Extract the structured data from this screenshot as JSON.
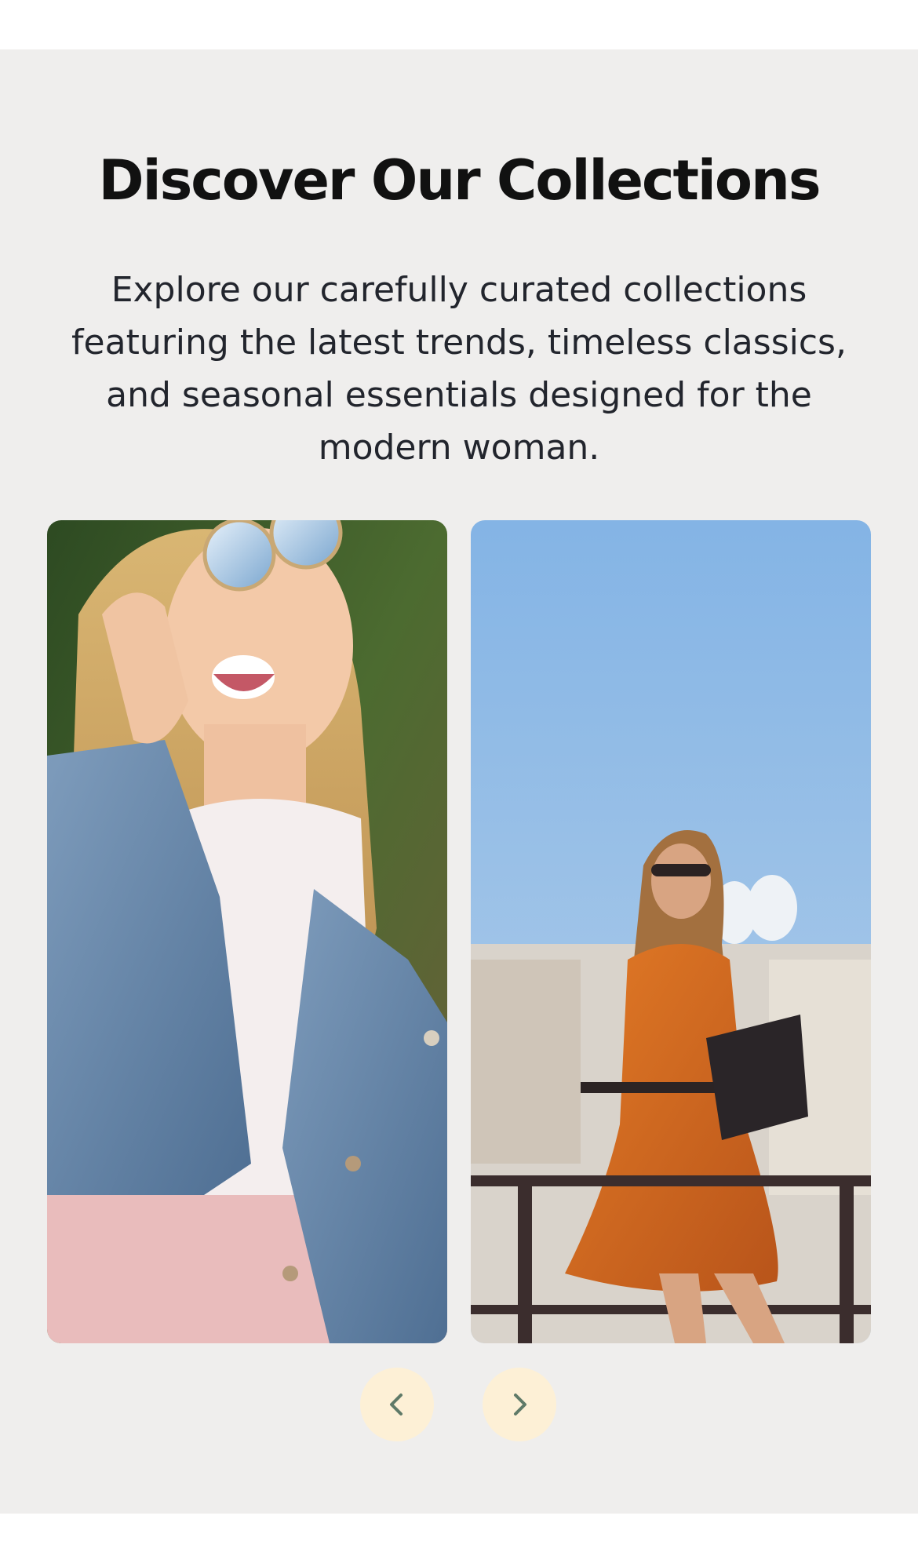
{
  "section": {
    "title": "Discover Our Collections",
    "description": "Explore our carefully curated collections featuring the latest trends, timeless classics, and seasonal essentials designed for the modern woman."
  },
  "cards": [
    {
      "image": "woman-sunglasses-denim-jacket-photo"
    },
    {
      "image": "woman-orange-dress-balcony-photo"
    }
  ],
  "carousel": {
    "prev_icon": "chevron-left-icon",
    "next_icon": "chevron-right-icon"
  },
  "colors": {
    "section_bg": "#efeeed",
    "nav_button_bg": "#fdf0d6",
    "nav_icon": "#5f7a68",
    "title": "#111111",
    "text": "#22252d"
  }
}
